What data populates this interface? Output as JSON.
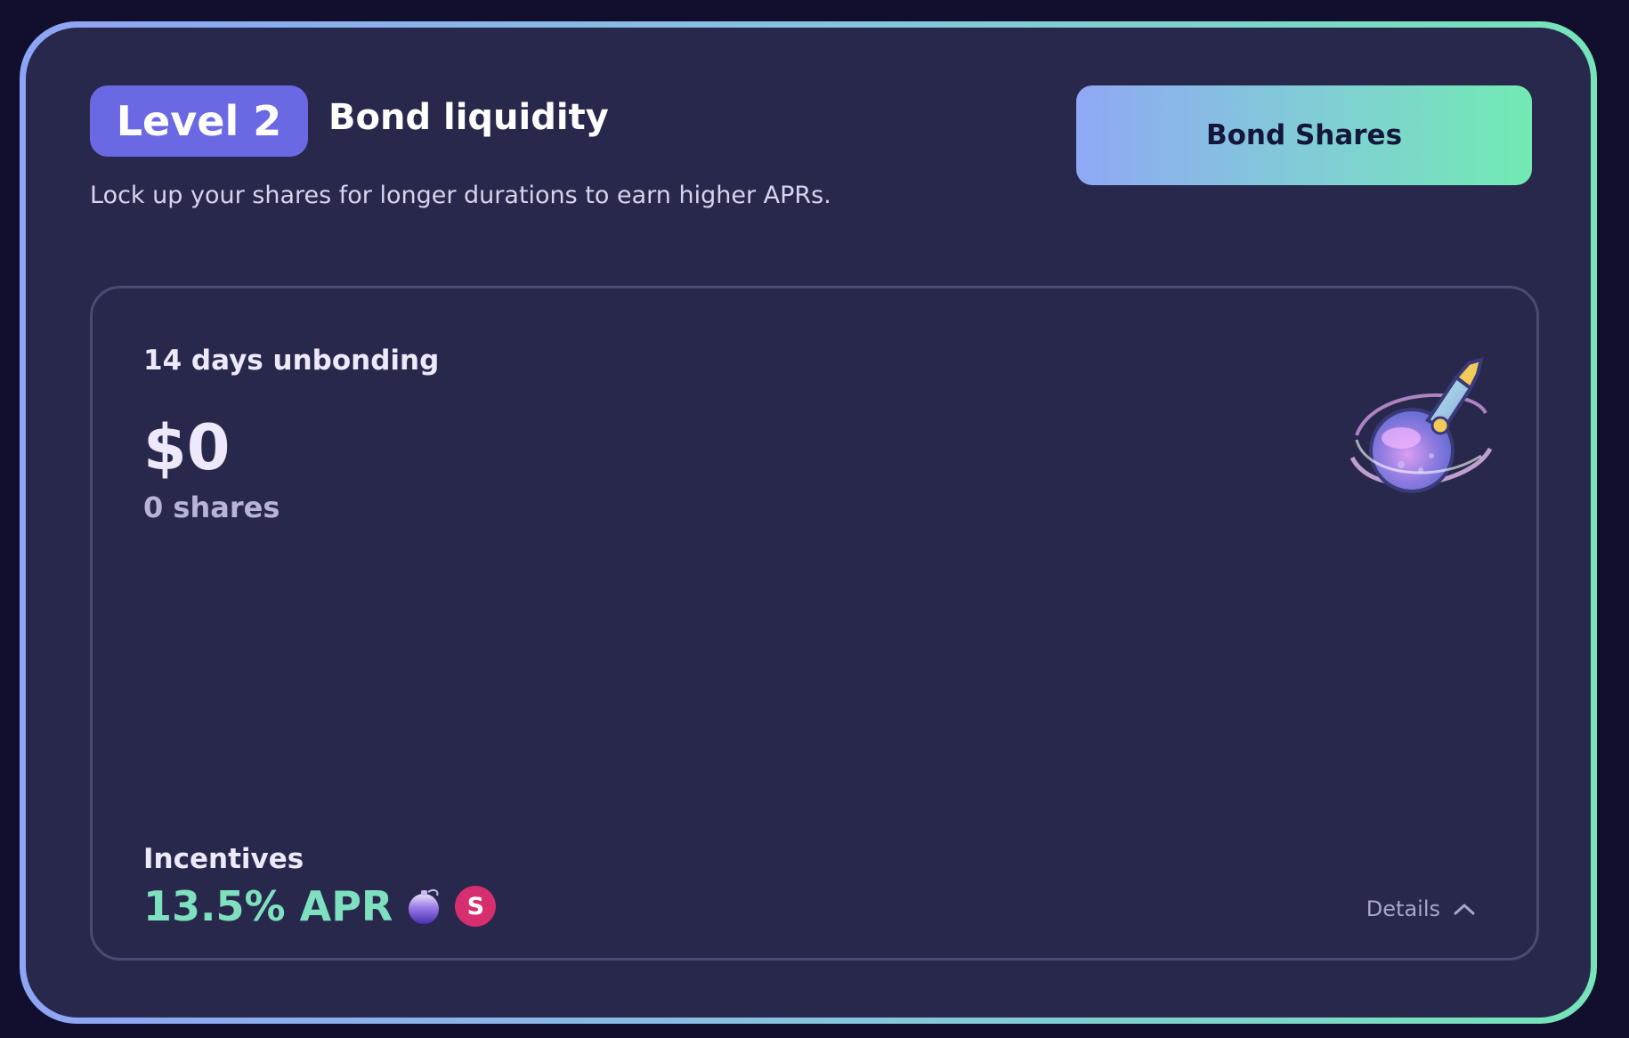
{
  "header": {
    "level_label": "Level 2",
    "title": "Bond liquidity",
    "description": "Lock up your shares for longer durations to earn higher APRs.",
    "bond_button_label": "Bond Shares"
  },
  "bond_card": {
    "title": "14 days unbonding",
    "amount": "$0",
    "shares": "0 shares",
    "illustration": "potion-bottle-icon",
    "incentives_label": "Incentives",
    "apr": "13.5% APR",
    "reward_tokens": [
      {
        "icon": "potion-token-icon"
      },
      {
        "icon": "s-token-icon",
        "letter": "S",
        "color": "#d62e6e"
      }
    ],
    "details_label": "Details",
    "details_icon": "chevron-up-icon"
  },
  "colors": {
    "accent_badge": "#6b68e3",
    "apr_text": "#7fe0bf",
    "gradient_start": "#8ea4f5",
    "gradient_end": "#76e4b8",
    "card_bg": "#28284d",
    "page_bg": "#120f2e"
  }
}
